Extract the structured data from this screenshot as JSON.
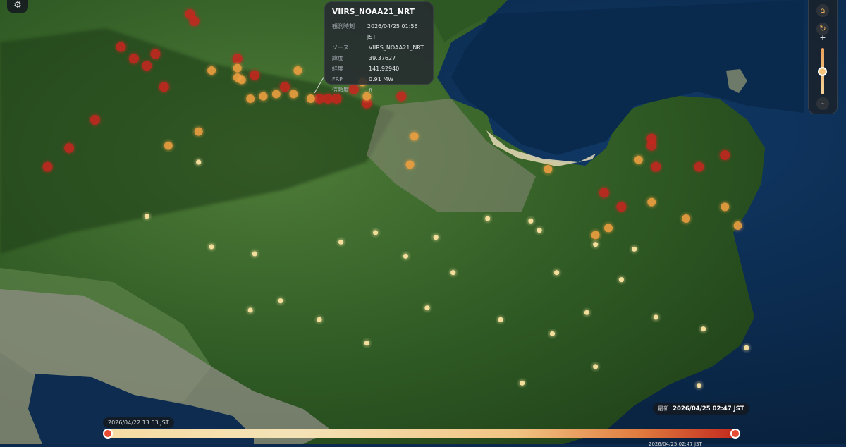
{
  "settings": {
    "icon": "gear-icon",
    "glyph": "⚙"
  },
  "popup": {
    "title": "VIIRS_NOAA21_NRT",
    "rows": [
      {
        "key": "観測時刻",
        "value": "2026/04/25 01:56 JST"
      },
      {
        "key": "ソース",
        "value": "VIIRS_NOAA21_NRT"
      },
      {
        "key": "緯度",
        "value": "39.37627"
      },
      {
        "key": "経度",
        "value": "141.92940"
      },
      {
        "key": "FRP",
        "value": "0.91 MW"
      },
      {
        "key": "信頼度",
        "value": "n"
      }
    ]
  },
  "controls": {
    "home_icon": "home-icon",
    "home_glyph": "⌂",
    "rotate_icon": "rotate-icon",
    "rotate_glyph": "↻",
    "zoom_in_label": "+",
    "zoom_out_label": "-",
    "zoom_level": 0.55
  },
  "timeline": {
    "start_label": "2026/04/22 13:53 JST",
    "latest_prefix": "最新",
    "latest_label": "2026/04/25 02:47 JST",
    "sub_label": "2026/04/25 02:47 JST"
  },
  "colors": {
    "ocean": "#0c2a4d",
    "land": "#3a6a2c",
    "urban": "#8c8a80",
    "hot": "#c8261e",
    "mid": "#f0a040",
    "cool": "#fbe3a0"
  },
  "hotspots": [
    {
      "lon": 141.878,
      "lat": 39.412,
      "level": "hot"
    },
    {
      "lon": 141.879,
      "lat": 39.409,
      "level": "hot"
    },
    {
      "lon": 141.862,
      "lat": 39.398,
      "level": "hot"
    },
    {
      "lon": 141.865,
      "lat": 39.393,
      "level": "hot"
    },
    {
      "lon": 141.868,
      "lat": 39.39,
      "level": "hot"
    },
    {
      "lon": 141.87,
      "lat": 39.395,
      "level": "hot"
    },
    {
      "lon": 141.889,
      "lat": 39.393,
      "level": "hot"
    },
    {
      "lon": 141.893,
      "lat": 39.386,
      "level": "hot"
    },
    {
      "lon": 141.9,
      "lat": 39.381,
      "level": "hot"
    },
    {
      "lon": 141.908,
      "lat": 39.376,
      "level": "hot"
    },
    {
      "lon": 141.91,
      "lat": 39.376,
      "level": "hot"
    },
    {
      "lon": 141.916,
      "lat": 39.38,
      "level": "hot"
    },
    {
      "lon": 141.919,
      "lat": 39.374,
      "level": "hot"
    },
    {
      "lon": 141.927,
      "lat": 39.377,
      "level": "hot"
    },
    {
      "lon": 141.856,
      "lat": 39.367,
      "level": "hot"
    },
    {
      "lon": 141.85,
      "lat": 39.355,
      "level": "hot"
    },
    {
      "lon": 141.845,
      "lat": 39.347,
      "level": "hot"
    },
    {
      "lon": 141.872,
      "lat": 39.381,
      "level": "hot"
    },
    {
      "lon": 141.985,
      "lat": 39.359,
      "level": "hot"
    },
    {
      "lon": 141.985,
      "lat": 39.356,
      "level": "hot"
    },
    {
      "lon": 141.986,
      "lat": 39.347,
      "level": "hot"
    },
    {
      "lon": 141.996,
      "lat": 39.347,
      "level": "hot"
    },
    {
      "lon": 142.002,
      "lat": 39.352,
      "level": "hot"
    },
    {
      "lon": 141.974,
      "lat": 39.336,
      "level": "hot"
    },
    {
      "lon": 141.978,
      "lat": 39.33,
      "level": "hot"
    },
    {
      "lon": 141.912,
      "lat": 39.376,
      "level": "hot"
    },
    {
      "lon": 141.883,
      "lat": 39.388,
      "level": "mid"
    },
    {
      "lon": 141.89,
      "lat": 39.384,
      "level": "mid"
    },
    {
      "lon": 141.903,
      "lat": 39.388,
      "level": "mid"
    },
    {
      "lon": 141.918,
      "lat": 39.383,
      "level": "mid"
    },
    {
      "lon": 141.919,
      "lat": 39.377,
      "level": "mid"
    },
    {
      "lon": 141.892,
      "lat": 39.376,
      "level": "mid"
    },
    {
      "lon": 141.895,
      "lat": 39.377,
      "level": "mid"
    },
    {
      "lon": 141.898,
      "lat": 39.378,
      "level": "mid"
    },
    {
      "lon": 141.902,
      "lat": 39.378,
      "level": "mid"
    },
    {
      "lon": 141.906,
      "lat": 39.376,
      "level": "mid"
    },
    {
      "lon": 141.93,
      "lat": 39.36,
      "level": "mid"
    },
    {
      "lon": 141.929,
      "lat": 39.348,
      "level": "mid"
    },
    {
      "lon": 141.88,
      "lat": 39.362,
      "level": "mid"
    },
    {
      "lon": 141.873,
      "lat": 39.356,
      "level": "mid"
    },
    {
      "lon": 141.961,
      "lat": 39.346,
      "level": "mid"
    },
    {
      "lon": 141.982,
      "lat": 39.35,
      "level": "mid"
    },
    {
      "lon": 141.985,
      "lat": 39.332,
      "level": "mid"
    },
    {
      "lon": 141.993,
      "lat": 39.325,
      "level": "mid"
    },
    {
      "lon": 141.975,
      "lat": 39.321,
      "level": "mid"
    },
    {
      "lon": 141.972,
      "lat": 39.318,
      "level": "mid"
    },
    {
      "lon": 142.002,
      "lat": 39.33,
      "level": "mid"
    },
    {
      "lon": 142.005,
      "lat": 39.322,
      "level": "mid"
    },
    {
      "lon": 141.889,
      "lat": 39.385,
      "level": "mid"
    },
    {
      "lon": 141.889,
      "lat": 39.389,
      "level": "mid"
    },
    {
      "lon": 141.88,
      "lat": 39.349,
      "level": "cool"
    },
    {
      "lon": 141.868,
      "lat": 39.326,
      "level": "cool"
    },
    {
      "lon": 141.883,
      "lat": 39.313,
      "level": "cool"
    },
    {
      "lon": 141.893,
      "lat": 39.31,
      "level": "cool"
    },
    {
      "lon": 141.913,
      "lat": 39.315,
      "level": "cool"
    },
    {
      "lon": 141.921,
      "lat": 39.319,
      "level": "cool"
    },
    {
      "lon": 141.935,
      "lat": 39.317,
      "level": "cool"
    },
    {
      "lon": 141.947,
      "lat": 39.325,
      "level": "cool"
    },
    {
      "lon": 141.959,
      "lat": 39.32,
      "level": "cool"
    },
    {
      "lon": 141.957,
      "lat": 39.324,
      "level": "cool"
    },
    {
      "lon": 141.972,
      "lat": 39.314,
      "level": "cool"
    },
    {
      "lon": 141.981,
      "lat": 39.312,
      "level": "cool"
    },
    {
      "lon": 141.963,
      "lat": 39.302,
      "level": "cool"
    },
    {
      "lon": 141.978,
      "lat": 39.299,
      "level": "cool"
    },
    {
      "lon": 141.939,
      "lat": 39.302,
      "level": "cool"
    },
    {
      "lon": 141.928,
      "lat": 39.309,
      "level": "cool"
    },
    {
      "lon": 141.899,
      "lat": 39.29,
      "level": "cool"
    },
    {
      "lon": 141.892,
      "lat": 39.286,
      "level": "cool"
    },
    {
      "lon": 141.908,
      "lat": 39.282,
      "level": "cool"
    },
    {
      "lon": 141.933,
      "lat": 39.287,
      "level": "cool"
    },
    {
      "lon": 141.95,
      "lat": 39.282,
      "level": "cool"
    },
    {
      "lon": 141.962,
      "lat": 39.276,
      "level": "cool"
    },
    {
      "lon": 141.97,
      "lat": 39.285,
      "level": "cool"
    },
    {
      "lon": 141.986,
      "lat": 39.283,
      "level": "cool"
    },
    {
      "lon": 141.997,
      "lat": 39.278,
      "level": "cool"
    },
    {
      "lon": 142.007,
      "lat": 39.27,
      "level": "cool"
    },
    {
      "lon": 141.919,
      "lat": 39.272,
      "level": "cool"
    },
    {
      "lon": 141.955,
      "lat": 39.255,
      "level": "cool"
    },
    {
      "lon": 141.996,
      "lat": 39.254,
      "level": "cool"
    },
    {
      "lon": 141.972,
      "lat": 39.262,
      "level": "cool"
    }
  ]
}
